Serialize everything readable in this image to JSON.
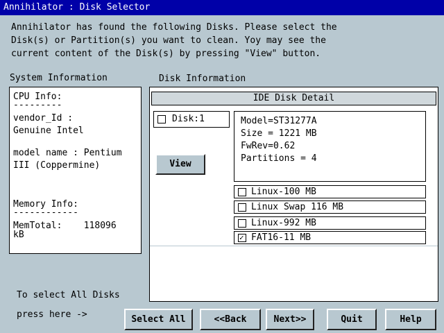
{
  "window": {
    "title": "Annihilator : Disk Selector"
  },
  "intro": {
    "line1": "Annihilator has found the following Disks. Please select the",
    "line2": "Disk(s) or Partition(s) you want to clean. Yoy may see the",
    "line3": "current content of the Disk(s) by pressing \"View\" button."
  },
  "system_info": {
    "label": "System Information",
    "cpu_heading": "CPU Info:",
    "cpu_underline": "---------",
    "vendor_label": "vendor_Id :",
    "vendor_value": "Genuine Intel",
    "model_line1": "model name : Pentium",
    "model_line2": "III (Coppermine)",
    "memory_heading": "Memory Info:",
    "memory_underline": "------------",
    "memtotal_line1": "MemTotal:    118096",
    "memtotal_line2": "kB"
  },
  "disk_info": {
    "label": "Disk Information",
    "header": "IDE Disk Detail",
    "disk": {
      "label": "Disk:1",
      "checked": false
    },
    "details": {
      "model": "Model=ST31277A",
      "size": "Size = 1221 MB",
      "fwrev": "FwRev=0.62",
      "partitions": "Partitions = 4"
    },
    "view_button": "View",
    "partition_rows": [
      {
        "label": "Linux-100 MB",
        "checked": false
      },
      {
        "label": "Linux Swap 116 MB",
        "checked": false
      },
      {
        "label": "Linux-992 MB",
        "checked": false
      },
      {
        "label": "FAT16-11 MB",
        "checked": true
      }
    ],
    "checkmark_glyph": "✓"
  },
  "footer": {
    "select_all_hint1": "To select All Disks",
    "select_all_hint2": "press here ->",
    "buttons": {
      "select_all": "Select All",
      "back": "<<Back",
      "next": "Next>>",
      "quit": "Quit",
      "help": "Help"
    }
  }
}
